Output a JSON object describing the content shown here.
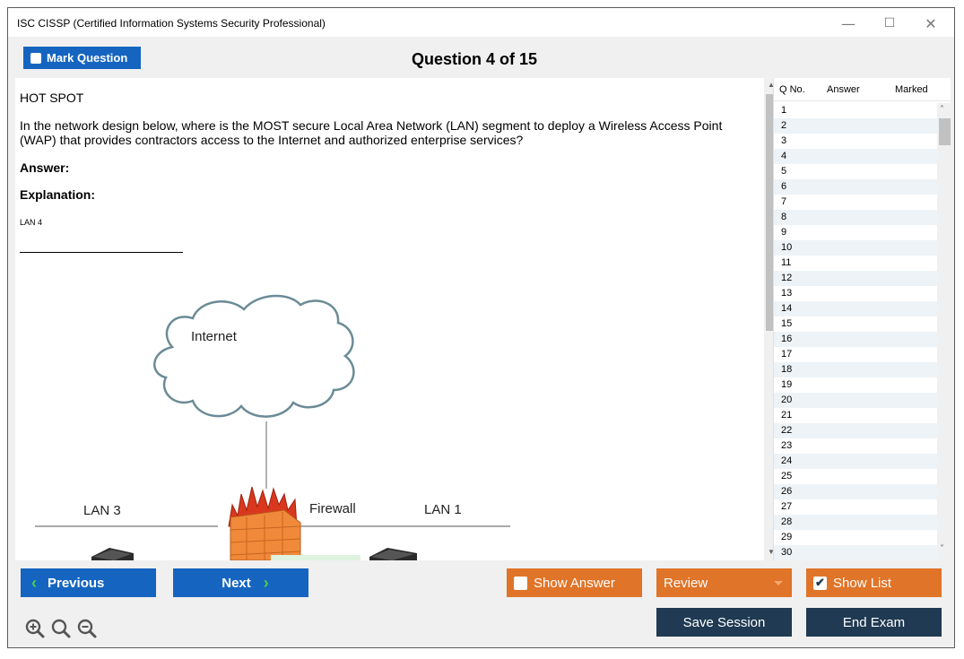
{
  "window": {
    "title": "ISC CISSP (Certified Information Systems Security Professional)",
    "minimize": "—",
    "maximize": "☐",
    "close": "✕"
  },
  "header": {
    "mark_label": "Mark Question",
    "question_title": "Question 4 of 15"
  },
  "question": {
    "type": "HOT SPOT",
    "text": "In the network design below, where is the MOST secure Local Area Network (LAN) segment to deploy a Wireless Access Point (WAP) that provides contractors access to the Internet and authorized enterprise services?",
    "answer_label": "Answer:",
    "explanation_label": "Explanation:",
    "explanation_value": "LAN 4"
  },
  "diagram": {
    "internet_label": "Internet",
    "firewall_label": "Firewall",
    "lan3_label": "LAN 3",
    "lan1_label": "LAN 1"
  },
  "question_list": {
    "columns": [
      "Q No.",
      "Answer",
      "Marked"
    ],
    "rows": [
      "1",
      "2",
      "3",
      "4",
      "5",
      "6",
      "7",
      "8",
      "9",
      "10",
      "11",
      "12",
      "13",
      "14",
      "15",
      "16",
      "17",
      "18",
      "19",
      "20",
      "21",
      "22",
      "23",
      "24",
      "25",
      "26",
      "27",
      "28",
      "29",
      "30"
    ]
  },
  "toolbar": {
    "previous_label": "Previous",
    "next_label": "Next",
    "show_answer_label": "Show Answer",
    "review_label": "Review",
    "show_list_label": "Show List",
    "save_session_label": "Save Session",
    "end_exam_label": "End Exam",
    "prev_chevron": "‹",
    "next_chevron": "›",
    "check": "✔"
  },
  "colors": {
    "blue": "#1565c0",
    "orange": "#e07428",
    "dark": "#1f3a52",
    "chevron_green": "#4ccf4c",
    "cloud_stroke": "#6b8b96",
    "firewall_orange": "#f08a3a"
  }
}
